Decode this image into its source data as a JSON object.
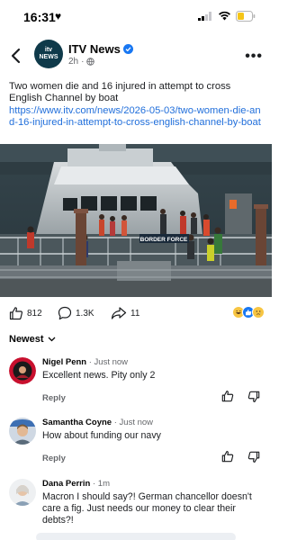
{
  "status_bar": {
    "time": "16:31"
  },
  "header": {
    "page_name": "ITV News",
    "avatar_line1": "itv",
    "avatar_line2": "NEWS",
    "post_age": "2h",
    "post_age_sep": "·"
  },
  "post": {
    "text": "Two women die and 16 injured in attempt to cross English Channel by boat",
    "link": "https://www.itv.com/news/2026-05-03/two-women-die-and-16-injured-in-attempt-to-cross-english-channel-by-boat",
    "image_sign": "BORDER FORCE"
  },
  "engagement": {
    "likes": "812",
    "comments": "1.3K",
    "shares": "11"
  },
  "sort_label": "Newest",
  "comments": [
    {
      "name": "Nigel Penn",
      "time": "Just now",
      "text": "Excellent news. Pity only 2",
      "reply": "Reply"
    },
    {
      "name": "Samantha Coyne",
      "time": "Just now",
      "text": "How about funding our navy",
      "reply": "Reply"
    },
    {
      "name": "Dana Perrin",
      "time": "1m",
      "text": "Macron I should say?! German chancellor doesn't care a fig. Just needs our money to clear their debts?!",
      "reply": ""
    }
  ],
  "colors": {
    "link": "#216fdb",
    "verified": "#1877f2",
    "secondary_text": "#65676b"
  }
}
